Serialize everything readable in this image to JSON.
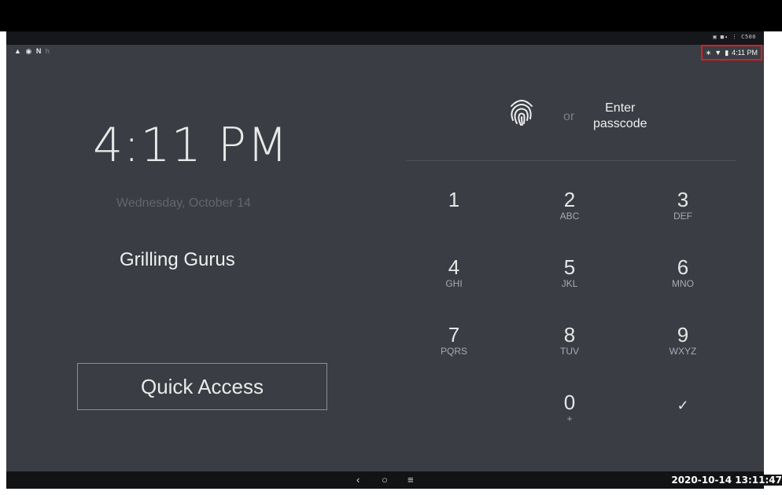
{
  "device": {
    "model": "C500",
    "strip_icons": [
      "camera-icon",
      "video-icon",
      "menu-dots-icon"
    ]
  },
  "status": {
    "notif_icons": [
      "warning-icon",
      "notification-icon",
      "n-icon",
      "small-icon"
    ],
    "time": "4:11 PM",
    "icons": [
      "bluetooth-icon",
      "wifi-icon",
      "battery-icon"
    ]
  },
  "lock": {
    "clock": "4:11 PM",
    "date": "Wednesday, October 14",
    "org_name": "Grilling Gurus",
    "quick_access": "Quick Access"
  },
  "auth": {
    "or": "or",
    "enter_passcode": "Enter\npasscode"
  },
  "keypad": [
    {
      "num": "1",
      "letters": ""
    },
    {
      "num": "2",
      "letters": "ABC"
    },
    {
      "num": "3",
      "letters": "DEF"
    },
    {
      "num": "4",
      "letters": "GHI"
    },
    {
      "num": "5",
      "letters": "JKL"
    },
    {
      "num": "6",
      "letters": "MNO"
    },
    {
      "num": "7",
      "letters": "PQRS"
    },
    {
      "num": "8",
      "letters": "TUV"
    },
    {
      "num": "9",
      "letters": "WXYZ"
    },
    {
      "num": "0",
      "letters": "+"
    },
    {
      "num": "✓",
      "letters": ""
    }
  ],
  "nav": {
    "back": "‹",
    "home": "○",
    "recents": "≡"
  },
  "recording": {
    "timestamp": "2020-10-14 13:11:47"
  },
  "colors": {
    "screen_bg": "#3a3d43",
    "highlight": "#e11b22"
  }
}
